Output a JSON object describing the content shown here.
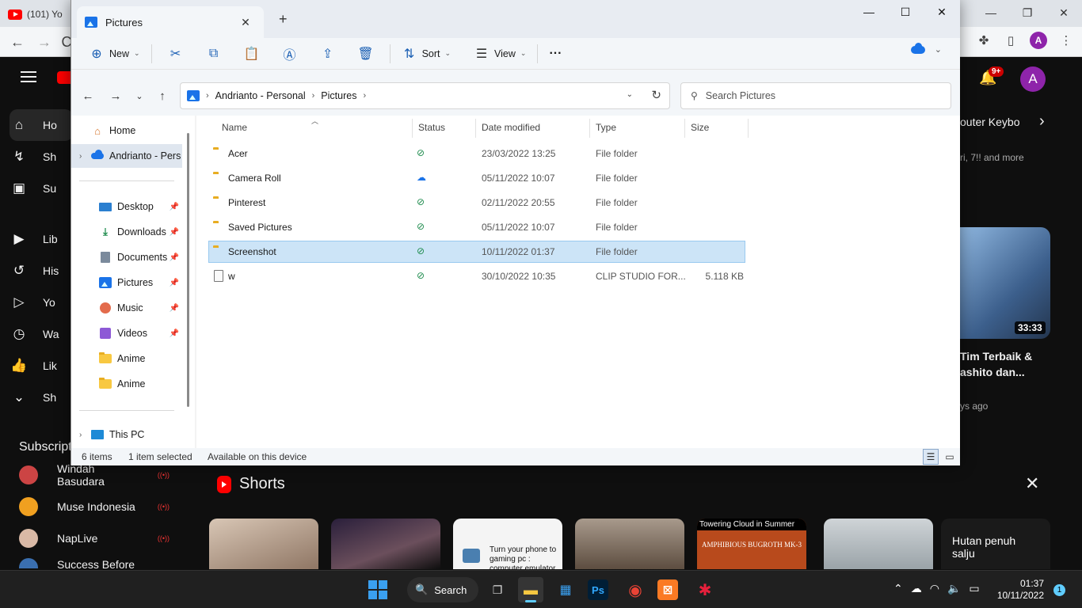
{
  "chrome": {
    "tab_title": "(101) Yo",
    "avatar": "A"
  },
  "youtube": {
    "sidebar": [
      {
        "label": "Ho",
        "icon": "home-icon"
      },
      {
        "label": "Sh",
        "icon": "shorts-icon"
      },
      {
        "label": "Su",
        "icon": "subscriptions-icon"
      },
      {
        "label": "Lib",
        "icon": "library-icon"
      },
      {
        "label": "His",
        "icon": "history-icon"
      },
      {
        "label": "Yo",
        "icon": "your-videos-icon"
      },
      {
        "label": "Wa",
        "icon": "watch-later-icon"
      },
      {
        "label": "Lik",
        "icon": "liked-icon"
      },
      {
        "label": "Sh",
        "icon": "show-more-icon"
      }
    ],
    "subscriptions_title": "Subscripti",
    "subscriptions": [
      {
        "name": "Windah Basudara"
      },
      {
        "name": "Muse Indonesia"
      },
      {
        "name": "NapLive"
      },
      {
        "name": "Success Before"
      }
    ],
    "notif_count": "9+",
    "avatar": "A",
    "chip": "outer Keybo",
    "desc": "ri, 7!! and more",
    "video": {
      "duration": "33:33",
      "title": "Tim Terbaik & ashito dan...",
      "meta": "ys ago"
    },
    "shorts_title": "Shorts",
    "shorts_captions": [
      "Turn your phone to gaming pc : computer emulator",
      "Towering Cloud in Summer",
      "AMPHIBIOUS BUGROTH MK-3",
      "Hutan penuh salju"
    ]
  },
  "explorer": {
    "tab_title": "Pictures",
    "commands": {
      "new": "New",
      "sort": "Sort",
      "view": "View",
      "more": "···"
    },
    "breadcrumb": [
      "Andrianto - Personal",
      "Pictures"
    ],
    "search_placeholder": "Search Pictures",
    "nav": {
      "home": "Home",
      "onedrive": "Andrianto - Pers",
      "desktop": "Desktop",
      "downloads": "Downloads",
      "documents": "Documents",
      "pictures": "Pictures",
      "music": "Music",
      "videos": "Videos",
      "anime1": "Anime",
      "anime2": "Anime",
      "thispc": "This PC"
    },
    "columns": {
      "name": "Name",
      "status": "Status",
      "date": "Date modified",
      "type": "Type",
      "size": "Size"
    },
    "rows": [
      {
        "name": "Acer",
        "status": "synced",
        "date": "23/03/2022 13:25",
        "type": "File folder",
        "size": ""
      },
      {
        "name": "Camera Roll",
        "status": "cloud",
        "date": "05/11/2022 10:07",
        "type": "File folder",
        "size": ""
      },
      {
        "name": "Pinterest",
        "status": "synced",
        "date": "02/11/2022 20:55",
        "type": "File folder",
        "size": ""
      },
      {
        "name": "Saved Pictures",
        "status": "synced",
        "date": "05/11/2022 10:07",
        "type": "File folder",
        "size": ""
      },
      {
        "name": "Screenshot",
        "status": "synced",
        "date": "10/11/2022 01:37",
        "type": "File folder",
        "size": ""
      },
      {
        "name": "w",
        "status": "synced",
        "date": "30/10/2022 10:35",
        "type": "CLIP STUDIO FOR...",
        "size": "5.118 KB"
      }
    ],
    "selected_row": 4,
    "status": {
      "items": "6 items",
      "selected": "1 item selected",
      "availability": "Available on this device"
    }
  },
  "taskbar": {
    "search": "Search",
    "time": "01:37",
    "date": "10/11/2022",
    "notifications": "1"
  }
}
